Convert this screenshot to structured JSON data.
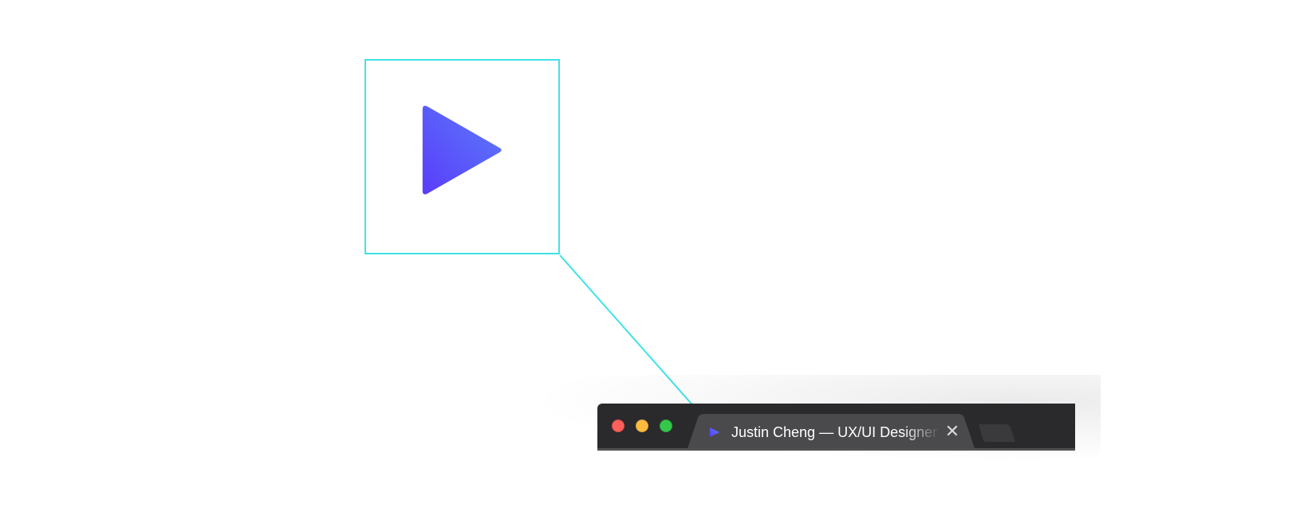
{
  "callout": {
    "icon": "play-icon",
    "colors": {
      "border": "#3fe3e6",
      "icon_gradient_start": "#5b7cfa",
      "icon_gradient_end": "#5a3cfb"
    }
  },
  "browser": {
    "traffic_lights": {
      "close_color": "#fc605b",
      "minimize_color": "#fdbc40",
      "maximize_color": "#34c84a"
    },
    "tab": {
      "favicon": "play-icon",
      "title": "Justin Cheng — UX/UI Designer",
      "close_icon": "close-icon"
    },
    "new_tab_icon": "new-tab-icon"
  }
}
